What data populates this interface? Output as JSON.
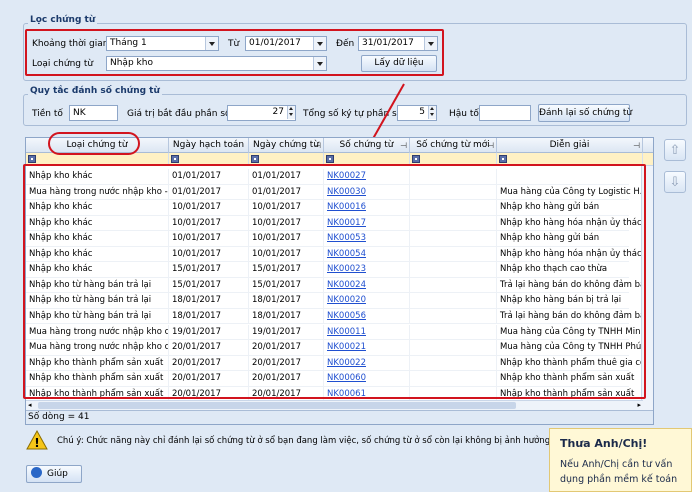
{
  "filter": {
    "title": "Lọc chứng từ",
    "period_label": "Khoảng thời gian",
    "period_value": "Tháng 1",
    "from_label": "Từ",
    "from_value": "01/01/2017",
    "to_label": "Đến",
    "to_value": "31/01/2017",
    "doc_type_label": "Loại chứng từ",
    "doc_type_value": "Nhập kho",
    "fetch_button": "Lấy dữ liệu"
  },
  "numbering": {
    "title": "Quy tắc đánh số chứng từ",
    "prefix_label": "Tiền tố",
    "prefix_value": "NK",
    "start_label": "Giá trị bắt đầu phần số",
    "start_value": "27",
    "digits_label": "Tổng số ký tự phần số",
    "digits_value": "5",
    "suffix_label": "Hậu tố",
    "suffix_value": "",
    "renumber_button": "Đánh lại số chứng từ"
  },
  "grid": {
    "columns": [
      "Loại chứng từ",
      "Ngày hạch toán",
      "Ngày chứng từ",
      "Số chứng từ",
      "Số chứng từ mới",
      "Diễn giải"
    ],
    "rows": [
      [
        "Nhập kho khác",
        "01/01/2017",
        "01/01/2017",
        "NK00027",
        "",
        ""
      ],
      [
        "Mua hàng trong nước nhập kho -...",
        "01/01/2017",
        "01/01/2017",
        "NK00030",
        "",
        "Mua hàng của Công ty Logistic H..."
      ],
      [
        "Nhập kho khác",
        "10/01/2017",
        "10/01/2017",
        "NK00016",
        "",
        "Nhập kho hàng gửi bán"
      ],
      [
        "Nhập kho khác",
        "10/01/2017",
        "10/01/2017",
        "NK00017",
        "",
        "Nhập kho hàng hóa nhận ủy thác..."
      ],
      [
        "Nhập kho khác",
        "10/01/2017",
        "10/01/2017",
        "NK00053",
        "",
        "Nhập kho hàng gửi bán"
      ],
      [
        "Nhập kho khác",
        "10/01/2017",
        "10/01/2017",
        "NK00054",
        "",
        "Nhập kho hàng hóa nhận ủy thác..."
      ],
      [
        "Nhập kho khác",
        "15/01/2017",
        "15/01/2017",
        "NK00023",
        "",
        "Nhập kho thạch cao thừa"
      ],
      [
        "Nhập kho từ hàng bán trả lại",
        "15/01/2017",
        "15/01/2017",
        "NK00024",
        "",
        "Trả lại hàng bán do không đảm bả..."
      ],
      [
        "Nhập kho từ hàng bán trả lại",
        "18/01/2017",
        "18/01/2017",
        "NK00020",
        "",
        "Nhập kho hàng bán bị trả lại"
      ],
      [
        "Nhập kho từ hàng bán trả lại",
        "18/01/2017",
        "18/01/2017",
        "NK00056",
        "",
        "Trả lại hàng bán do không đảm bảo ch..."
      ],
      [
        "Mua hàng trong nước nhập kho c...",
        "19/01/2017",
        "19/01/2017",
        "NK00011",
        "",
        "Mua hàng của Công ty TNHH Min..."
      ],
      [
        "Mua hàng trong nước nhập kho c...",
        "20/01/2017",
        "20/01/2017",
        "NK00021",
        "",
        "Mua hàng của Công ty TNHH Phú..."
      ],
      [
        "Nhập kho thành phẩm sản xuất",
        "20/01/2017",
        "20/01/2017",
        "NK00022",
        "",
        "Nhập kho thành phẩm thuê gia cô..."
      ],
      [
        "Nhập kho thành phẩm sản xuất",
        "20/01/2017",
        "20/01/2017",
        "NK00060",
        "",
        "Nhập kho thành phẩm sản xuất"
      ],
      [
        "Nhập kho thành phẩm sản xuất",
        "20/01/2017",
        "20/01/2017",
        "NK00061",
        "",
        "Nhập kho thành phẩm sản xuất"
      ]
    ],
    "row_count": "Số dòng = 41"
  },
  "note": "Chú ý: Chức năng này chỉ đánh lại số chứng từ ở sổ bạn đang làm việc, số chứng từ ở sổ còn lại không bị ảnh hưởng.",
  "help_button": "Giúp",
  "tip": {
    "title": "Thưa Anh/Chị!",
    "line1": "Nếu Anh/Chị cần tư vấn",
    "line2": "dụng phần mềm kế toán"
  },
  "colors": {
    "highlight": "#d2141e",
    "link": "#1f4fd0",
    "filter_row": "#fff1c4"
  }
}
